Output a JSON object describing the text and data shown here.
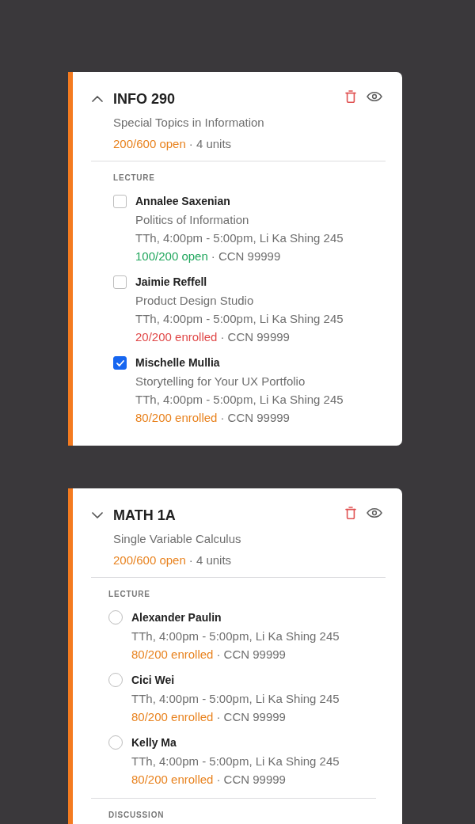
{
  "cards": [
    {
      "kind": "checkbox",
      "expanded": true,
      "code": "INFO 290",
      "title": "Special Topics in Information",
      "status": {
        "text": "200/600 open",
        "color": "#e8821e"
      },
      "detail": "· 4 units",
      "sections": [
        {
          "label": "LECTURE",
          "options": [
            {
              "name": "Annalee Saxenian",
              "title": "Politics of Information",
              "schedule": "TTh, 4:00pm - 5:00pm, Li Ka Shing 245",
              "status": {
                "text": "100/200 open",
                "color": "#1fa65c"
              },
              "detail": "· CCN 99999",
              "checked": false
            },
            {
              "name": "Jaimie Reffell",
              "title": "Product Design Studio",
              "schedule": "TTh, 4:00pm - 5:00pm, Li Ka Shing 245",
              "status": {
                "text": "20/200 enrolled",
                "color": "#e04848"
              },
              "detail": "· CCN 99999",
              "checked": false
            },
            {
              "name": "Mischelle Mullia",
              "title": "Storytelling for Your UX Portfolio",
              "schedule": "TTh, 4:00pm - 5:00pm, Li Ka Shing 245",
              "status": {
                "text": "80/200 enrolled",
                "color": "#e8821e"
              },
              "detail": "· CCN 99999",
              "checked": true
            }
          ]
        }
      ]
    },
    {
      "kind": "radio",
      "expanded": false,
      "code": "MATH 1A",
      "title": "Single Variable Calculus",
      "status": {
        "text": "200/600 open",
        "color": "#e8821e"
      },
      "detail": "· 4 units",
      "sections": [
        {
          "label": "LECTURE",
          "options": [
            {
              "name": "Alexander Paulin",
              "schedule": "TTh, 4:00pm - 5:00pm, Li Ka Shing 245",
              "status": {
                "text": "80/200 enrolled",
                "color": "#e8821e"
              },
              "detail": "· CCN 99999",
              "selected": false
            },
            {
              "name": "Cici Wei",
              "schedule": "TTh, 4:00pm - 5:00pm, Li Ka Shing 245",
              "status": {
                "text": "80/200 enrolled",
                "color": "#e8821e"
              },
              "detail": "· CCN 99999",
              "selected": false
            },
            {
              "name": "Kelly Ma",
              "schedule": "TTh, 4:00pm - 5:00pm, Li Ka Shing 245",
              "status": {
                "text": "80/200 enrolled",
                "color": "#e8821e"
              },
              "detail": "· CCN 99999",
              "selected": false
            }
          ]
        },
        {
          "label": "DISCUSSION"
        }
      ]
    }
  ]
}
